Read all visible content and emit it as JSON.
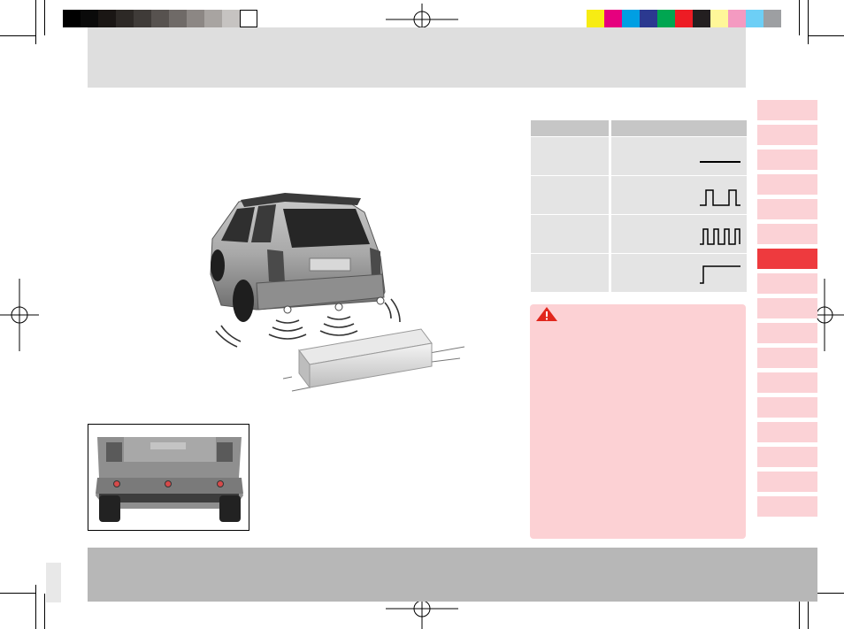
{
  "print_marks": {
    "gray_swatches": [
      "#000000",
      "#0a0a0a",
      "#1a1614",
      "#2d2926",
      "#3f3b38",
      "#57524f",
      "#6f6a67",
      "#8c8784",
      "#a8a4a1",
      "#c6c3c1",
      "#ffffff"
    ],
    "color_swatches": [
      "#f7ec13",
      "#e6007e",
      "#009fe3",
      "#2b3990",
      "#00a651",
      "#ed1c24",
      "#231f20",
      "#fff799",
      "#f49ac1",
      "#6dcff6",
      "#9d9fa2"
    ]
  },
  "colors": {
    "active_tab": "#ee3a3e",
    "tab": "#fbd2d6",
    "warning_bg": "#fcd1d4",
    "warning_icon": "#e1261c"
  },
  "side_tabs": {
    "count": 17,
    "active_index": 6
  },
  "signal_table": {
    "rows": [
      {
        "signal": "continuous"
      },
      {
        "signal": "slow-pulse"
      },
      {
        "signal": "fast-pulse"
      },
      {
        "signal": "step"
      }
    ]
  },
  "warning": {
    "icon": "warning-triangle-icon"
  },
  "illustrations": {
    "car": "rear-parking-sensor-car-icon",
    "bumper": "rear-bumper-sensors-icon"
  }
}
